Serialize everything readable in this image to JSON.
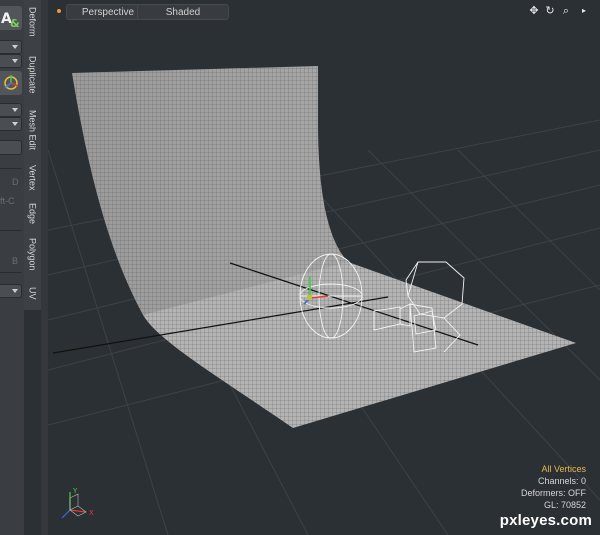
{
  "left_panel": {
    "text_fragments": [
      "D",
      "ft-C",
      "B"
    ]
  },
  "side_tabs": [
    "Deform",
    "Duplicate",
    "Mesh Edit",
    "Vertex",
    "Edge",
    "Polygon",
    "UV"
  ],
  "viewport": {
    "view_label": "Perspective",
    "shading_label": "Shaded",
    "icons": [
      "move-icon",
      "rotate-icon",
      "zoom-icon",
      "expand-icon"
    ],
    "status": {
      "selection": "All Vertices",
      "channels": "Channels: 0",
      "deformers": "Deformers: OFF",
      "gl": "GL: 70852"
    },
    "accent_color": "#e6b84a"
  },
  "watermark": "pxleyes.com"
}
